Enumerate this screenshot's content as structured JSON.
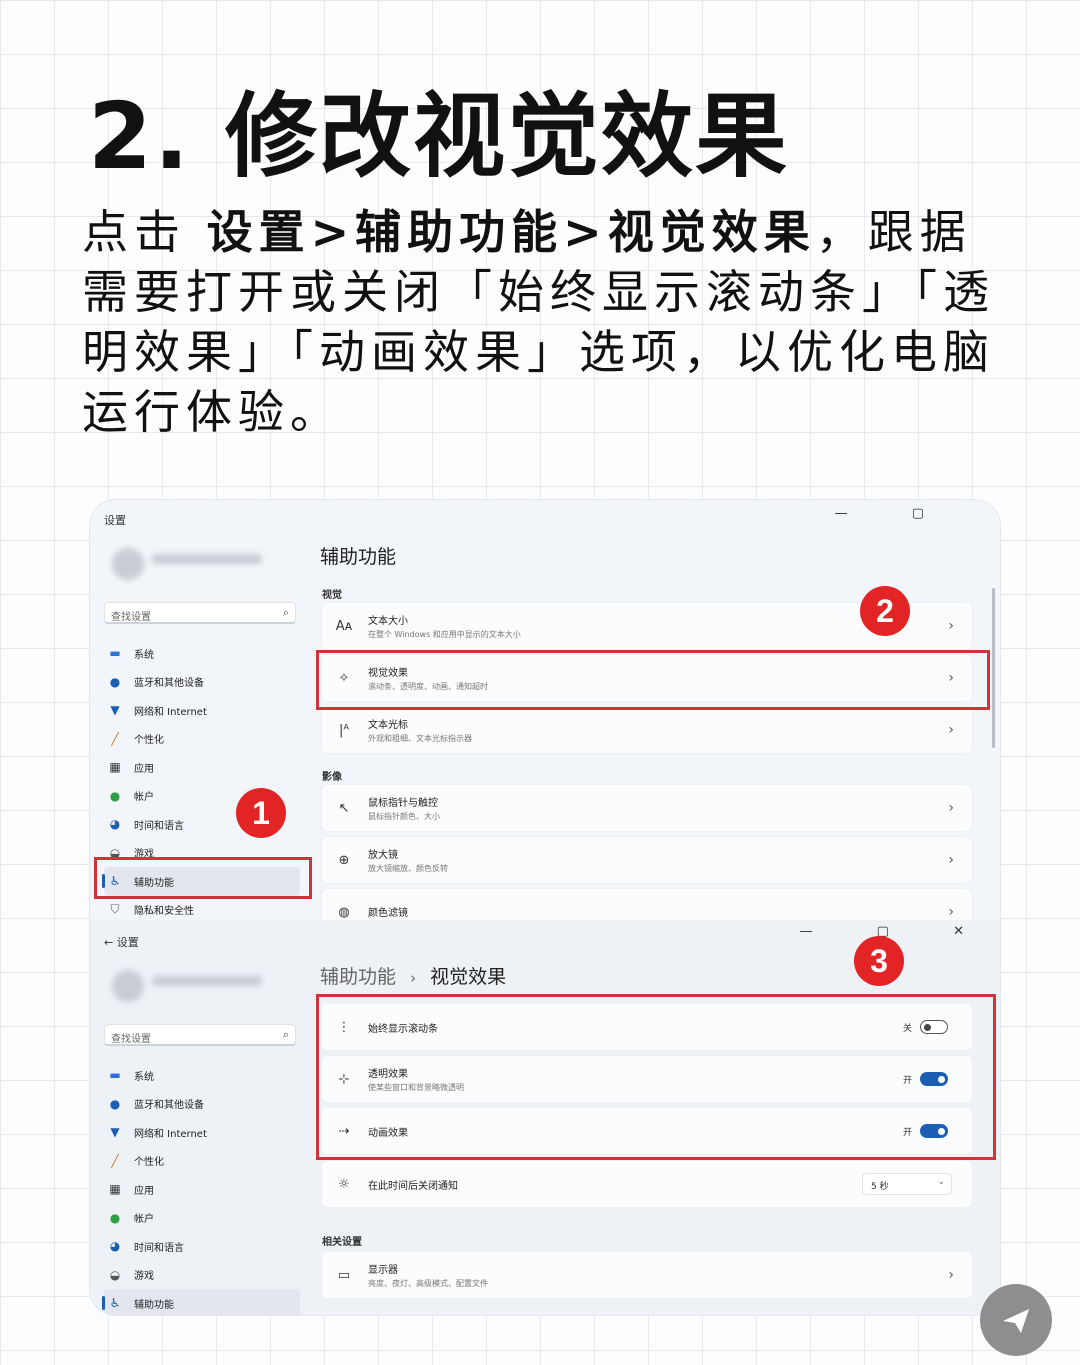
{
  "title": "2. 修改视觉效果",
  "intro": {
    "pre": "点击 ",
    "path": "设置>辅助功能>视觉效果",
    "post": "，跟据需要打开或关闭「始终显示滚动条」「透明效果」「动画效果」选项，以优化电脑运行体验。"
  },
  "top_window": {
    "app_title": "设置",
    "controls": "— ▢",
    "search_placeholder": "查找设置",
    "nav": [
      {
        "icon": "system-icon",
        "label": "系统"
      },
      {
        "icon": "bluetooth-icon",
        "label": "蓝牙和其他设备"
      },
      {
        "icon": "wifi-icon",
        "label": "网络和 Internet"
      },
      {
        "icon": "brush-icon",
        "label": "个性化"
      },
      {
        "icon": "apps-icon",
        "label": "应用"
      },
      {
        "icon": "account-icon",
        "label": "帐户"
      },
      {
        "icon": "clock-globe-icon",
        "label": "时间和语言"
      },
      {
        "icon": "gamepad-icon",
        "label": "游戏"
      },
      {
        "icon": "accessibility-icon",
        "label": "辅助功能"
      },
      {
        "icon": "shield-icon",
        "label": "隐私和安全性"
      }
    ],
    "page_title": "辅助功能",
    "section_vision": "视觉",
    "rows_vision": [
      {
        "icon": "text-size-icon",
        "title": "文本大小",
        "sub": "在整个 Windows 和应用中显示的文本大小"
      },
      {
        "icon": "visual-effects-icon",
        "title": "视觉效果",
        "sub": "滚动条、透明度、动画、通知超时"
      },
      {
        "icon": "text-cursor-icon",
        "title": "文本光标",
        "sub": "外观和粗细、文本光标指示器"
      }
    ],
    "section_hearing": "影像",
    "rows_more": [
      {
        "icon": "mouse-pointer-icon",
        "title": "鼠标指针与触控",
        "sub": "鼠标指针颜色、大小"
      },
      {
        "icon": "magnifier-icon",
        "title": "放大镜",
        "sub": "放大镜缩放、颜色反转"
      },
      {
        "icon": "color-filter-icon",
        "title": "颜色滤镜",
        "sub": ""
      }
    ]
  },
  "bottom_window": {
    "app_title": "设置",
    "controls": "— ▢ ✕",
    "search_placeholder": "查找设置",
    "nav": [
      {
        "icon": "system-icon",
        "label": "系统"
      },
      {
        "icon": "bluetooth-icon",
        "label": "蓝牙和其他设备"
      },
      {
        "icon": "wifi-icon",
        "label": "网络和 Internet"
      },
      {
        "icon": "brush-icon",
        "label": "个性化"
      },
      {
        "icon": "apps-icon",
        "label": "应用"
      },
      {
        "icon": "account-icon",
        "label": "帐户"
      },
      {
        "icon": "clock-globe-icon",
        "label": "时间和语言"
      },
      {
        "icon": "gamepad-icon",
        "label": "游戏"
      },
      {
        "icon": "accessibility-icon",
        "label": "辅助功能"
      }
    ],
    "breadcrumb_parent": "辅助功能",
    "breadcrumb_sep": "›",
    "breadcrumb_current": "视觉效果",
    "toggles": [
      {
        "icon": "scrollbar-icon",
        "title": "始终显示滚动条",
        "sub": "",
        "state_label": "关",
        "on": false
      },
      {
        "icon": "transparency-icon",
        "title": "透明效果",
        "sub": "使某些窗口和背景略微透明",
        "state_label": "开",
        "on": true
      },
      {
        "icon": "animation-icon",
        "title": "动画效果",
        "sub": "",
        "state_label": "开",
        "on": true
      }
    ],
    "notify_row": {
      "icon": "sun-icon",
      "title": "在此时间后关闭通知",
      "value": "5 秒"
    },
    "related_label": "相关设置",
    "display_row": {
      "icon": "monitor-icon",
      "title": "显示器",
      "sub": "亮度、夜灯、高级模式、配置文件"
    }
  },
  "badges": [
    "1",
    "2",
    "3"
  ],
  "colors": {
    "accent": "#1a5fb4",
    "highlight": "#d23238",
    "badge": "#e32424"
  }
}
